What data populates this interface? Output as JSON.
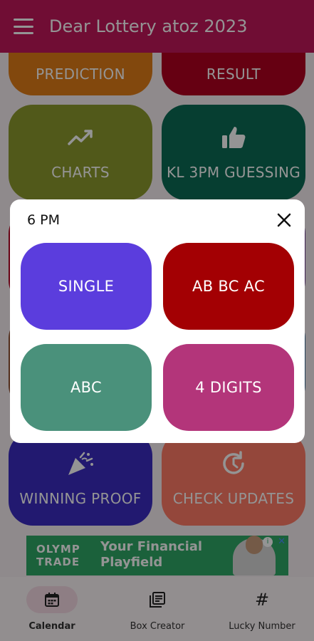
{
  "app": {
    "title": "Dear Lottery atoz 2023"
  },
  "tiles": {
    "prediction": {
      "label": "PREDICTION",
      "color": "#e07d18"
    },
    "result": {
      "label": "RESULT",
      "color": "#b00020"
    },
    "charts": {
      "label": "CHARTS",
      "color": "#8c9a2e"
    },
    "kl3pm": {
      "label": "KL 3PM GUESSING",
      "color": "#0b6b55"
    },
    "winning_proof": {
      "label": "WINNING PROOF",
      "color": "#3b2cc2"
    },
    "check_updates": {
      "label": "CHECK UPDATES",
      "color": "#ff7a66"
    }
  },
  "dialog": {
    "title": "6 PM",
    "options": [
      {
        "label": "SINGLE",
        "color": "#5b3ddd"
      },
      {
        "label": "AB BC AC",
        "color": "#a30003"
      },
      {
        "label": "ABC",
        "color": "#4a917b"
      },
      {
        "label": "4 DIGITS",
        "color": "#b3357a"
      }
    ]
  },
  "ad": {
    "brand_line1": "OLYMP",
    "brand_line2": "TRADE",
    "slogan_line1": "Your Financial",
    "slogan_line2": "Playfield",
    "info_glyph": "i",
    "close_glyph": "✕",
    "color": "#2fa866"
  },
  "nav": {
    "items": [
      {
        "label": "Calendar",
        "icon": "calendar-icon",
        "active": true
      },
      {
        "label": "Box Creator",
        "icon": "box-creator-icon",
        "active": false
      },
      {
        "label": "Lucky Number",
        "icon": "hash-icon",
        "active": false
      }
    ],
    "hash_glyph": "#"
  },
  "colors": {
    "appbar": "#c2185b",
    "dialog_bg": "#ffffff"
  }
}
